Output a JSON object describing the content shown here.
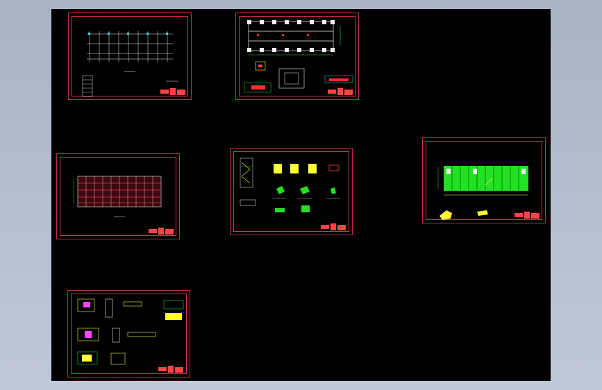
{
  "window": {
    "title": ""
  },
  "canvas": {
    "background": "#000000",
    "frame_color": "#c8284a"
  },
  "sheets": [
    {
      "id": "sheet-1",
      "description_visible": false
    },
    {
      "id": "sheet-2",
      "description_visible": false
    },
    {
      "id": "sheet-3",
      "description_visible": false
    },
    {
      "id": "sheet-4",
      "description_visible": false
    },
    {
      "id": "sheet-5",
      "description_visible": false
    },
    {
      "id": "sheet-6",
      "description_visible": false
    }
  ],
  "floating_note": "",
  "colors": {
    "red": "#ff2a2a",
    "green": "#22e022",
    "yellow": "#ffff33",
    "white": "#f0f0f0",
    "cyan": "#33e0e0",
    "magenta": "#ff44ff",
    "frame": "#c8284a"
  }
}
